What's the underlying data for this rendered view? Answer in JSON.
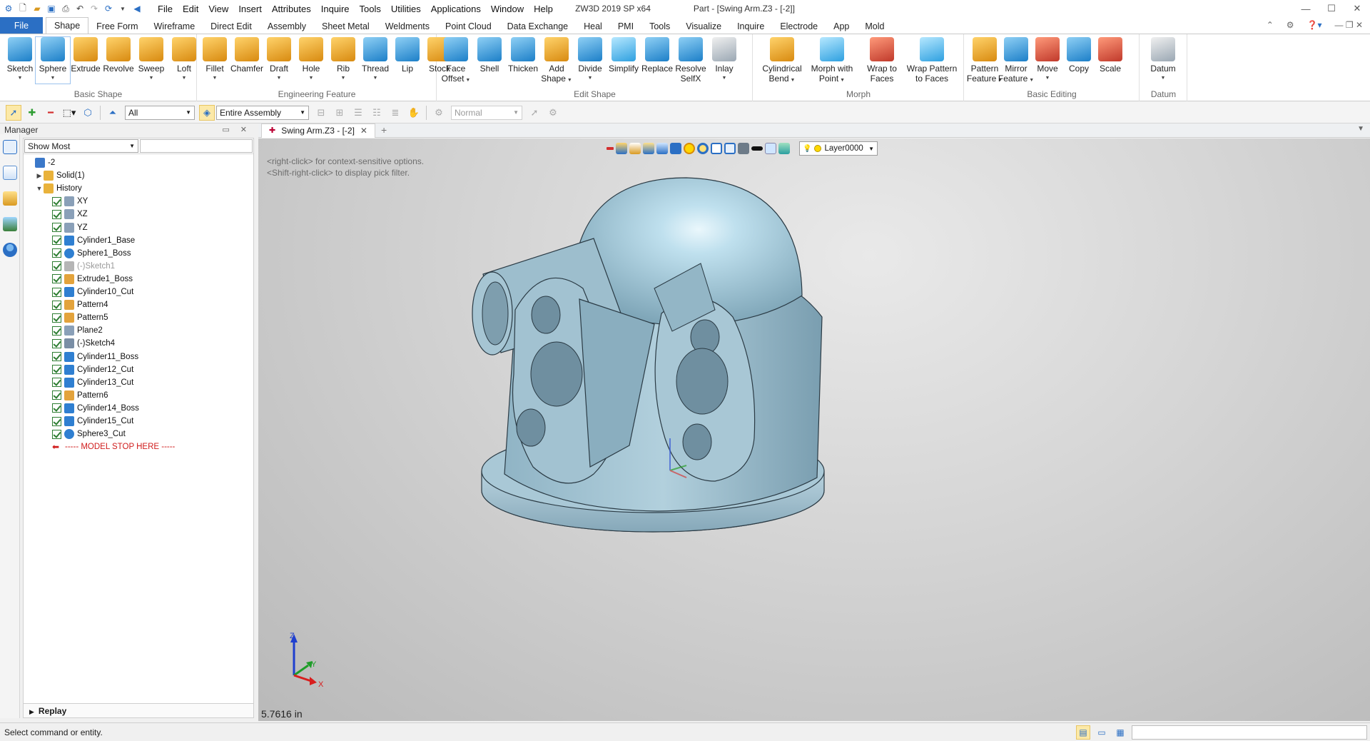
{
  "app": {
    "title": "ZW3D 2019 SP x64",
    "document_title": "Part - [Swing Arm.Z3 - [-2]]"
  },
  "menu": [
    "File",
    "Edit",
    "View",
    "Insert",
    "Attributes",
    "Inquire",
    "Tools",
    "Utilities",
    "Applications",
    "Window",
    "Help"
  ],
  "ribbon_tabs": [
    "File",
    "Shape",
    "Free Form",
    "Wireframe",
    "Direct Edit",
    "Assembly",
    "Sheet Metal",
    "Weldments",
    "Point Cloud",
    "Data Exchange",
    "Heal",
    "PMI",
    "Tools",
    "Visualize",
    "Inquire",
    "Electrode",
    "App",
    "Mold"
  ],
  "active_tab": "Shape",
  "ribbon_groups": {
    "basic_shape": {
      "label": "Basic Shape",
      "buttons": [
        {
          "label": "Sketch",
          "dropdown": true,
          "icon": "sketch-icon"
        },
        {
          "label": "Sphere",
          "dropdown": true,
          "icon": "sphere-icon"
        },
        {
          "label": "Extrude",
          "dropdown": false,
          "icon": "extrude-icon"
        },
        {
          "label": "Revolve",
          "dropdown": false,
          "icon": "revolve-icon"
        },
        {
          "label": "Sweep",
          "dropdown": true,
          "icon": "sweep-icon"
        },
        {
          "label": "Loft",
          "dropdown": true,
          "icon": "loft-icon"
        }
      ]
    },
    "engineering_feature": {
      "label": "Engineering Feature",
      "buttons": [
        {
          "label": "Fillet",
          "dropdown": true,
          "icon": "fillet-icon"
        },
        {
          "label": "Chamfer",
          "dropdown": false,
          "icon": "chamfer-icon"
        },
        {
          "label": "Draft",
          "dropdown": true,
          "icon": "draft-icon"
        },
        {
          "label": "Hole",
          "dropdown": true,
          "icon": "hole-icon"
        },
        {
          "label": "Rib",
          "dropdown": true,
          "icon": "rib-icon"
        },
        {
          "label": "Thread",
          "dropdown": true,
          "icon": "thread-icon"
        },
        {
          "label": "Lip",
          "dropdown": false,
          "icon": "lip-icon"
        },
        {
          "label": "Stock",
          "dropdown": false,
          "icon": "stock-icon"
        }
      ]
    },
    "edit_shape": {
      "label": "Edit Shape",
      "buttons": [
        {
          "label": "Face\nOffset",
          "dropdown": true,
          "icon": "face-offset-icon"
        },
        {
          "label": "Shell",
          "dropdown": false,
          "icon": "shell-icon"
        },
        {
          "label": "Thicken",
          "dropdown": false,
          "icon": "thicken-icon"
        },
        {
          "label": "Add\nShape",
          "dropdown": true,
          "icon": "add-shape-icon"
        },
        {
          "label": "Divide",
          "dropdown": true,
          "icon": "divide-icon"
        },
        {
          "label": "Simplify",
          "dropdown": false,
          "icon": "simplify-icon"
        },
        {
          "label": "Replace",
          "dropdown": false,
          "icon": "replace-icon"
        },
        {
          "label": "Resolve\nSelfX",
          "dropdown": false,
          "icon": "resolve-selfx-icon"
        },
        {
          "label": "Inlay",
          "dropdown": true,
          "icon": "inlay-icon"
        }
      ]
    },
    "morph": {
      "label": "Morph",
      "buttons": [
        {
          "label": "Cylindrical\nBend",
          "dropdown": true,
          "icon": "cylindrical-bend-icon"
        },
        {
          "label": "Morph with\nPoint",
          "dropdown": true,
          "icon": "morph-point-icon"
        },
        {
          "label": "Wrap to\nFaces",
          "dropdown": false,
          "icon": "wrap-faces-icon"
        },
        {
          "label": "Wrap Pattern\nto Faces",
          "dropdown": false,
          "icon": "wrap-pattern-icon"
        }
      ]
    },
    "basic_editing": {
      "label": "Basic Editing",
      "buttons": [
        {
          "label": "Pattern\nFeature",
          "dropdown": true,
          "icon": "pattern-icon"
        },
        {
          "label": "Mirror\nFeature",
          "dropdown": true,
          "icon": "mirror-icon"
        },
        {
          "label": "Move",
          "dropdown": true,
          "icon": "move-icon"
        },
        {
          "label": "Copy",
          "dropdown": false,
          "icon": "copy-icon"
        },
        {
          "label": "Scale",
          "dropdown": false,
          "icon": "scale-icon"
        }
      ]
    },
    "datum": {
      "label": "Datum",
      "buttons": [
        {
          "label": "Datum",
          "dropdown": true,
          "icon": "datum-icon"
        }
      ]
    }
  },
  "toolbar": {
    "filter_value": "All",
    "scope_value": "Entire Assembly",
    "render_mode_value": "Normal"
  },
  "manager": {
    "title": "Manager",
    "filter_value": "Show Most",
    "tree": [
      {
        "label": "-2",
        "level": 0,
        "expand": "",
        "check": false,
        "icon": "part-icon",
        "color": "#3b78c9"
      },
      {
        "label": "Solid(1)",
        "level": 1,
        "expand": "▶",
        "check": false,
        "icon": "folder-icon",
        "color": "#e9b23b"
      },
      {
        "label": "History",
        "level": 1,
        "expand": "▼",
        "check": false,
        "icon": "folder-icon",
        "color": "#e9b23b"
      },
      {
        "label": "XY",
        "level": 2,
        "expand": "",
        "check": true,
        "icon": "plane-icon",
        "color": "#8aa0b8"
      },
      {
        "label": "XZ",
        "level": 2,
        "expand": "",
        "check": true,
        "icon": "plane-icon",
        "color": "#8aa0b8"
      },
      {
        "label": "YZ",
        "level": 2,
        "expand": "",
        "check": true,
        "icon": "plane-icon",
        "color": "#8aa0b8"
      },
      {
        "label": "Cylinder1_Base",
        "level": 2,
        "expand": "",
        "check": true,
        "icon": "cylinder-icon",
        "color": "#2f7fd1"
      },
      {
        "label": "Sphere1_Boss",
        "level": 2,
        "expand": "",
        "check": true,
        "icon": "sphere-icon",
        "color": "#2f7fd1"
      },
      {
        "label": "(-)Sketch1",
        "level": 2,
        "expand": "",
        "check": true,
        "icon": "sketch-icon",
        "color": "#b5b5b5",
        "dim": true
      },
      {
        "label": "Extrude1_Boss",
        "level": 2,
        "expand": "",
        "check": true,
        "icon": "extrude-icon",
        "color": "#e3a33c"
      },
      {
        "label": "Cylinder10_Cut",
        "level": 2,
        "expand": "",
        "check": true,
        "icon": "cylinder-icon",
        "color": "#2f7fd1"
      },
      {
        "label": "Pattern4",
        "level": 2,
        "expand": "",
        "check": true,
        "icon": "pattern-icon",
        "color": "#e3a33c"
      },
      {
        "label": "Pattern5",
        "level": 2,
        "expand": "",
        "check": true,
        "icon": "pattern-icon",
        "color": "#e3a33c"
      },
      {
        "label": "Plane2",
        "level": 2,
        "expand": "",
        "check": true,
        "icon": "plane-icon",
        "color": "#8aa0b8"
      },
      {
        "label": "(-)Sketch4",
        "level": 2,
        "expand": "",
        "check": true,
        "icon": "sketch-icon",
        "color": "#7a8ea5"
      },
      {
        "label": "Cylinder11_Boss",
        "level": 2,
        "expand": "",
        "check": true,
        "icon": "cylinder-icon",
        "color": "#2f7fd1"
      },
      {
        "label": "Cylinder12_Cut",
        "level": 2,
        "expand": "",
        "check": true,
        "icon": "cylinder-icon",
        "color": "#2f7fd1"
      },
      {
        "label": "Cylinder13_Cut",
        "level": 2,
        "expand": "",
        "check": true,
        "icon": "cylinder-icon",
        "color": "#2f7fd1"
      },
      {
        "label": "Pattern6",
        "level": 2,
        "expand": "",
        "check": true,
        "icon": "pattern-icon",
        "color": "#e3a33c"
      },
      {
        "label": "Cylinder14_Boss",
        "level": 2,
        "expand": "",
        "check": true,
        "icon": "cylinder-icon",
        "color": "#2f7fd1"
      },
      {
        "label": "Cylinder15_Cut",
        "level": 2,
        "expand": "",
        "check": true,
        "icon": "cylinder-icon",
        "color": "#2f7fd1"
      },
      {
        "label": "Sphere3_Cut",
        "level": 2,
        "expand": "",
        "check": true,
        "icon": "sphere-icon",
        "color": "#2f7fd1"
      },
      {
        "label": "----- MODEL STOP HERE -----",
        "level": 2,
        "expand": "",
        "check": false,
        "icon": "stop-arrow-icon",
        "color": "#d01c1c",
        "stop": true
      }
    ],
    "replay_label": "Replay"
  },
  "document_tab": {
    "label": "Swing Arm.Z3 - [-2]"
  },
  "viewport": {
    "hint_line1": "<right-click> for context-sensitive options.",
    "hint_line2": "<Shift-right-click> to display pick filter.",
    "layer": "Layer0000",
    "measurement": "5.7616 in",
    "axes": {
      "x": "X",
      "y": "Y",
      "z": "Z"
    },
    "model_color": "#a9c6d3"
  },
  "status": {
    "text": "Select command or entity."
  }
}
